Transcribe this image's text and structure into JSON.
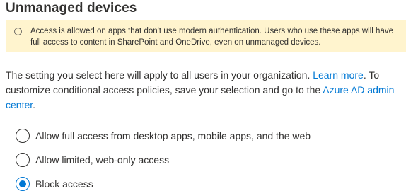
{
  "page": {
    "title": "Unmanaged devices"
  },
  "banner": {
    "icon": "info-icon",
    "text": "Access is allowed on apps that don't use modern authentication. Users who use these apps will have full access to content in SharePoint and OneDrive, even on unmanaged devices.",
    "background_color": "#fff4ce"
  },
  "description": {
    "text_part1": "The setting you select here will apply to all users in your organization. ",
    "learn_more_link": "Learn more",
    "text_part2": ". To customize conditional access policies, save your selection and go to the ",
    "azure_link": "Azure AD admin center",
    "text_part3": ".",
    "link_color": "#0078d4"
  },
  "options": [
    {
      "label": "Allow full access from desktop apps, mobile apps, and the web",
      "selected": false
    },
    {
      "label": "Allow limited, web-only access",
      "selected": false
    },
    {
      "label": "Block access",
      "selected": true
    }
  ],
  "accent_color": "#0078d4"
}
